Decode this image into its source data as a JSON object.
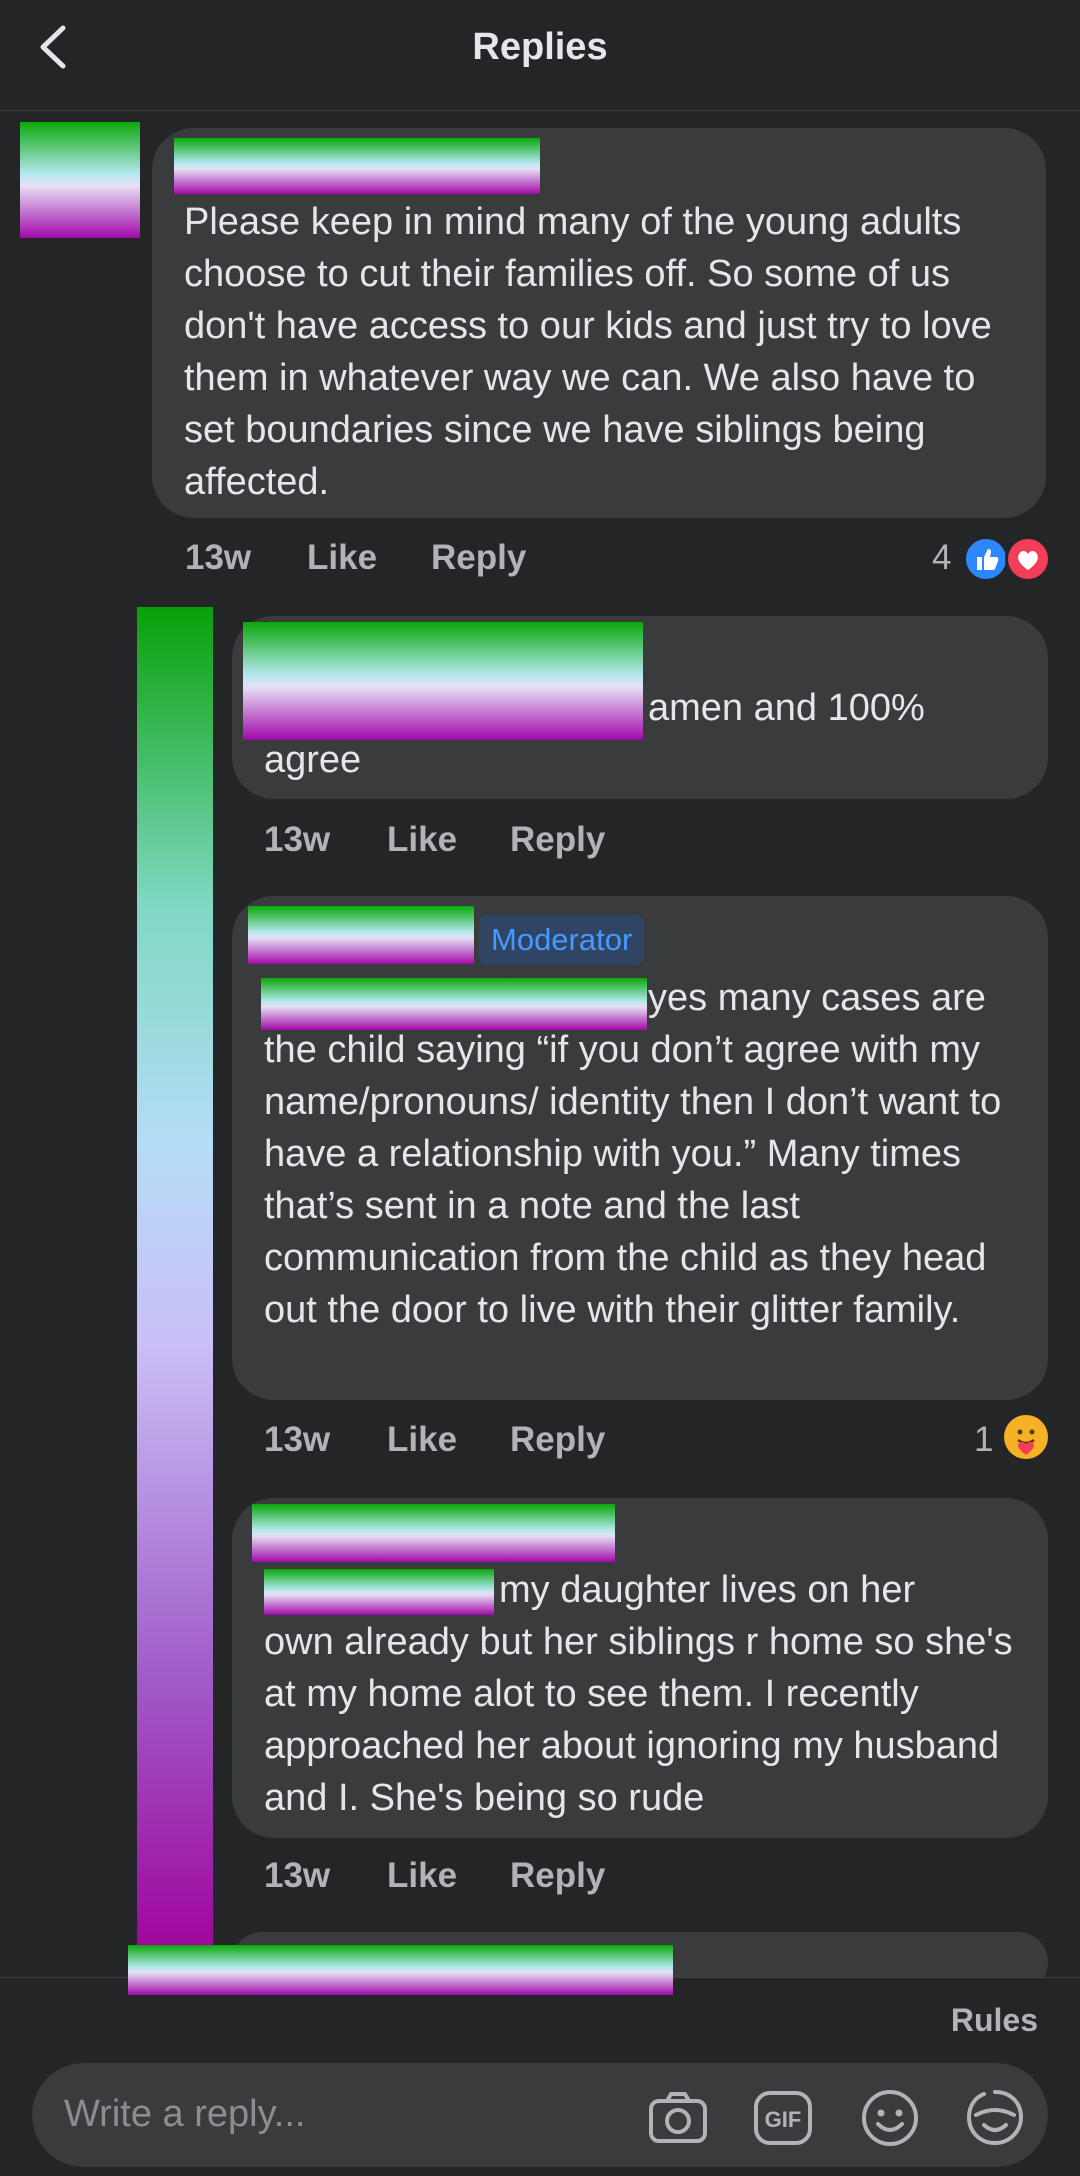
{
  "header": {
    "title": "Replies"
  },
  "comments": [
    {
      "text": "Please keep in mind many of the young adults choose to cut their families off. So some of us don't have access to our kids and just try to love them in whatever way we can. We also have to set boundaries since we have siblings being affected.",
      "time": "13w",
      "like": "Like",
      "reply": "Reply",
      "reaction_count": "4"
    },
    {
      "text_line1": "amen and 100%",
      "text_line2": "agree",
      "time": "13w",
      "like": "Like",
      "reply": "Reply"
    },
    {
      "badge": "Moderator",
      "text_line1": "yes many cases are",
      "text_rest": "the child saying “if you don’t agree with my name/pronouns/ identity then I don’t want to have a relationship with you.” Many times that’s sent in a note and the last communication from the child as they head out the door to live with their glitter family.",
      "time": "13w",
      "like": "Like",
      "reply": "Reply",
      "reaction_count": "1"
    },
    {
      "text_line1": "my daughter lives on her",
      "text_rest": "own already but her siblings r home so she's at my home alot to see them. I recently approached her about ignoring my husband and I. She's being so rude",
      "time": "13w",
      "like": "Like",
      "reply": "Reply"
    }
  ],
  "footer": {
    "rules": "Rules",
    "reply_placeholder": "Write a reply...",
    "icons": [
      "camera-icon",
      "gif-icon",
      "emoji-icon",
      "sticker-icon"
    ]
  },
  "colors": {
    "background": "#242526",
    "bubble": "#3a3b3c",
    "text": "#e4e6eb",
    "meta": "#b0b3b8",
    "like_blue": "#2d88ff",
    "love_red": "#f33e58",
    "moderator_badge_text": "#4599ff"
  }
}
